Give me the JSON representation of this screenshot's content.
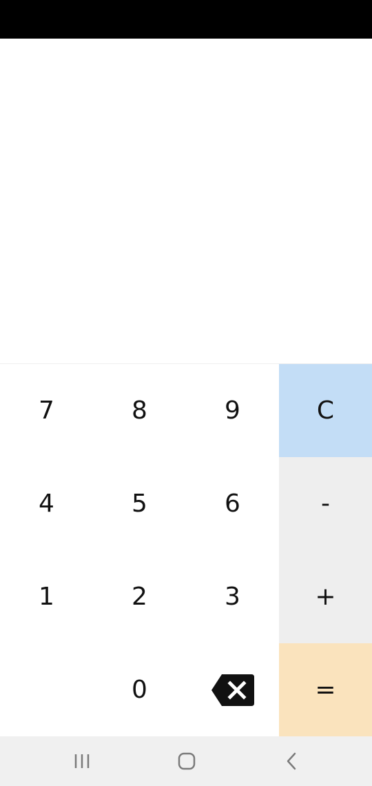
{
  "keypad": {
    "row1": {
      "k1": "7",
      "k2": "8",
      "k3": "9",
      "k4": "C"
    },
    "row2": {
      "k1": "4",
      "k2": "5",
      "k3": "6",
      "k4": "-"
    },
    "row3": {
      "k1": "1",
      "k2": "2",
      "k3": "3",
      "k4": "+"
    },
    "row4": {
      "k2": "0",
      "k4": "="
    },
    "backspace_icon": "backspace-icon"
  },
  "colors": {
    "status_bar": "#000000",
    "clear_key": "#c3ddf6",
    "operator_key": "#eeeeee",
    "equals_key": "#fae3bd",
    "nav_bar": "#f0f0f0"
  },
  "nav": {
    "recents_icon": "recents-icon",
    "home_icon": "home-icon",
    "back_icon": "back-icon"
  }
}
